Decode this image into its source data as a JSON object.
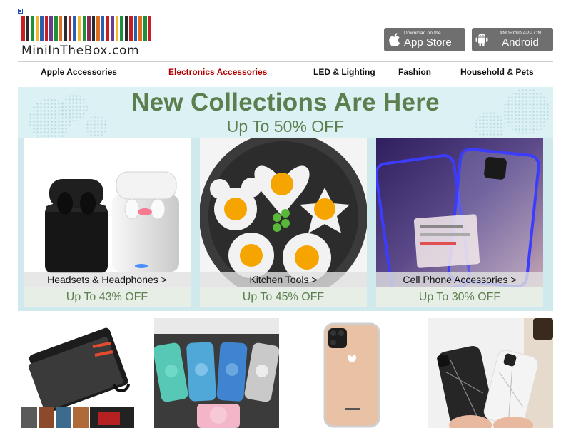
{
  "header": {
    "logo_text": "MiniInTheBox.com",
    "logo_stripe_colors": [
      "#c81d25",
      "#2b2b2b",
      "#1e8f3a",
      "#f2b632",
      "#2a5fb0",
      "#c81d25",
      "#6a3c8c",
      "#1e8f3a",
      "#e0701f",
      "#2b2b2b",
      "#c81d25",
      "#2a5fb0",
      "#f2b632",
      "#1e8f3a",
      "#8a2b52",
      "#2b2b2b",
      "#e0701f",
      "#2a5fb0",
      "#c81d25",
      "#6a3c8c",
      "#f2b632",
      "#1e8f3a",
      "#2b2b2b",
      "#c81d25",
      "#2a5fb0",
      "#e0701f",
      "#1e8f3a",
      "#c81d25"
    ],
    "app_store": {
      "small": "Download on the",
      "big": "App Store",
      "icon": "apple-icon"
    },
    "android": {
      "small": "ANDROID APP ON",
      "big": "Android",
      "icon": "android-icon"
    }
  },
  "nav": {
    "items": [
      {
        "label": "Apple Accessories",
        "active": false
      },
      {
        "label": "Electronics Accessories",
        "active": true
      },
      {
        "label": "LED & Lighting",
        "active": false
      },
      {
        "label": "Fashion",
        "active": false
      },
      {
        "label": "Household & Pets",
        "active": false
      }
    ],
    "active_color": "#b40000"
  },
  "banner": {
    "title": "New Collections Are Here",
    "subtitle": "Up To 50% OFF",
    "accent_color": "#5b7f4f",
    "cards": [
      {
        "label": "Headsets & Headphones >",
        "discount": "Up To 43% OFF",
        "image": "wireless-earbuds"
      },
      {
        "label": "Kitchen Tools >",
        "discount": "Up To 45% OFF",
        "image": "egg-molds"
      },
      {
        "label": "Cell Phone Accessories >",
        "discount": "Up To 30% OFF",
        "image": "magnetic-phone-case"
      }
    ]
  },
  "products": [
    {
      "image": "leather-wallet-phone-case"
    },
    {
      "image": "glitter-phone-cases-with-grips"
    },
    {
      "image": "clear-phone-case"
    },
    {
      "image": "marble-phone-cases"
    }
  ]
}
